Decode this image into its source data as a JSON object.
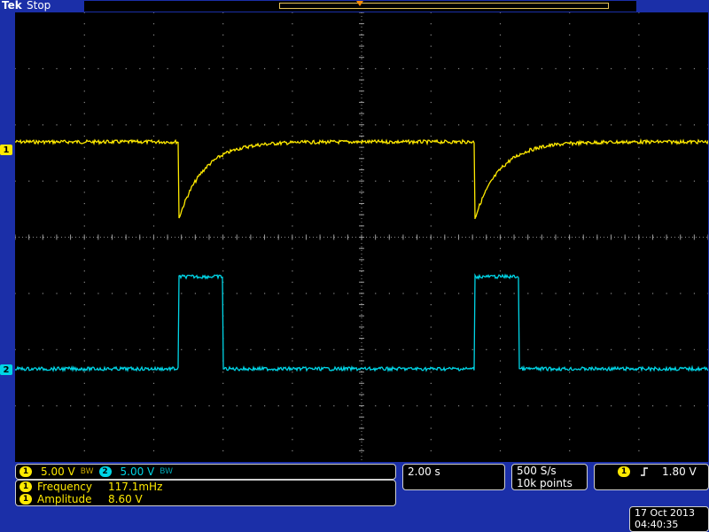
{
  "header": {
    "brand": "Tek",
    "status": "Stop"
  },
  "channels": {
    "ch1": {
      "marker": "1",
      "scale": "5.00 V",
      "color": "#ffea00"
    },
    "ch2": {
      "marker": "2",
      "scale": "5.00 V",
      "color": "#00d5e6"
    },
    "bw_icon_label": "BW"
  },
  "measurements": [
    {
      "channel": "1",
      "label": "Frequency",
      "value": "117.1mHz"
    },
    {
      "channel": "1",
      "label": "Amplitude",
      "value": "8.60 V"
    }
  ],
  "timebase": {
    "scale": "2.00 s"
  },
  "acquisition": {
    "sample_rate": "500 S/s",
    "record_length": "10k points"
  },
  "trigger": {
    "source": "1",
    "slope_icon": "rising-edge-icon",
    "level": "1.80 V"
  },
  "datetime": {
    "date": "17 Oct  2013",
    "time": "04:40:35"
  }
}
